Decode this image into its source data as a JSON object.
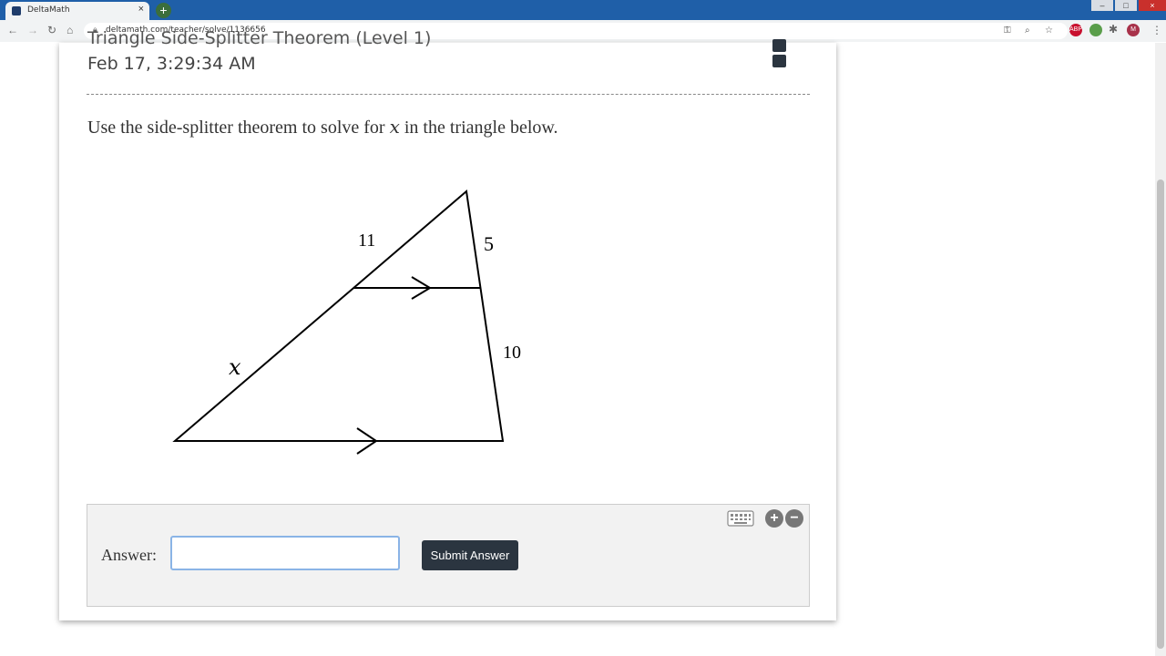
{
  "browser": {
    "tab_title": "DeltaMath",
    "tab_close": "×",
    "new_tab": "+",
    "url": "deltamath.com/teacher/solve/1136656",
    "window_controls": [
      "–",
      "□",
      "×"
    ],
    "extensions": [
      "ABP",
      "M"
    ]
  },
  "assignment": {
    "title_partial": "Triangle Side-Splitter Theorem (Level 1)",
    "timestamp": "Feb 17, 3:29:34 AM"
  },
  "question": {
    "prompt_before": "Use the side-splitter theorem to solve for ",
    "variable": "x",
    "prompt_after": " in the triangle below."
  },
  "figure": {
    "label_top_left": "11",
    "label_top_right": "5",
    "label_bottom_right": "10",
    "label_bottom_left": "x"
  },
  "answer": {
    "label": "Answer:",
    "value": "",
    "submit_label": "Submit Answer",
    "zoom_in": "+",
    "zoom_out": "−"
  }
}
